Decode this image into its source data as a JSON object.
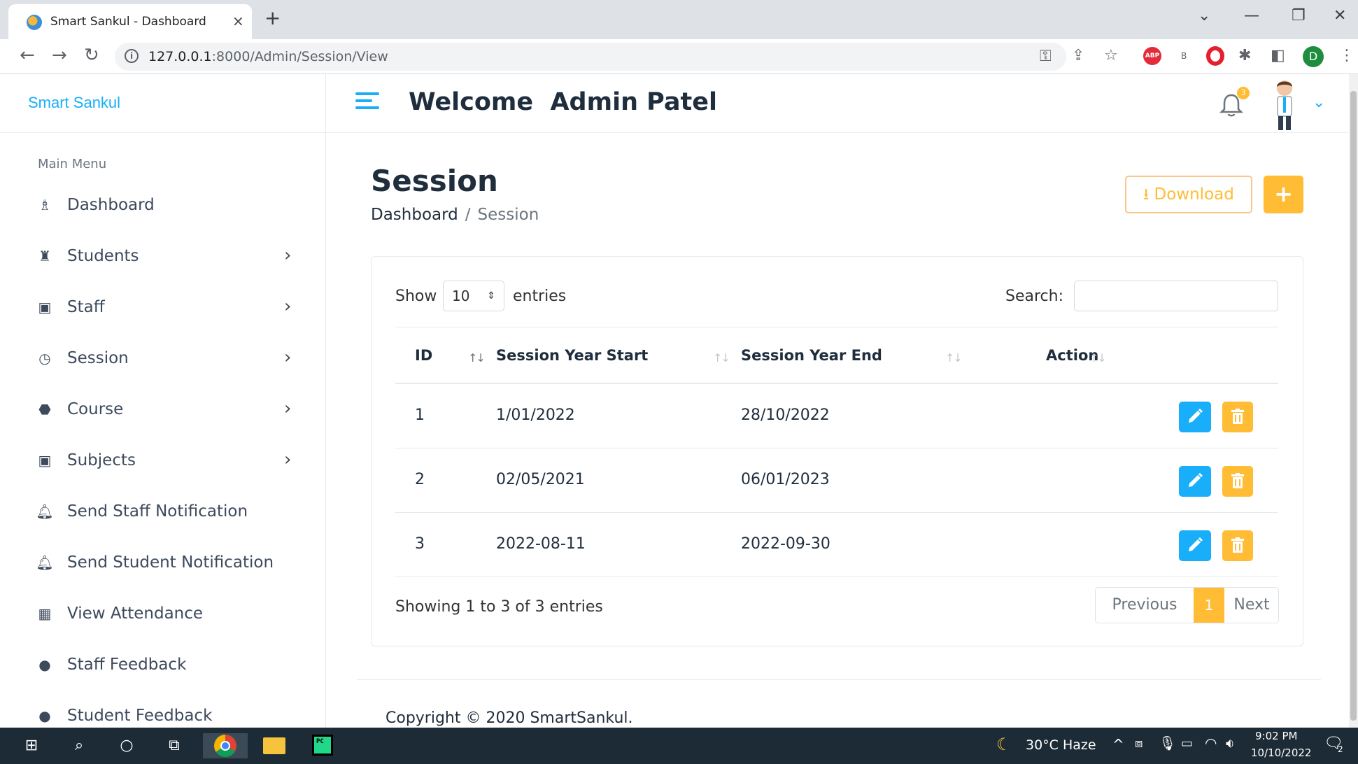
{
  "browser": {
    "tab_title": "Smart Sankul - Dashboard",
    "tab_close": "×",
    "new_tab": "+",
    "url_host": "127.0.0.1",
    "url_path": ":8000/Admin/Session/View"
  },
  "sidebar": {
    "brand": "Smart Sankul",
    "menu_title": "Main Menu",
    "items": [
      {
        "label": "Dashboard",
        "icon": "dashboard-icon",
        "has_submenu": false
      },
      {
        "label": "Students",
        "icon": "graduate-icon",
        "has_submenu": true
      },
      {
        "label": "Staff",
        "icon": "chalkboard-teacher-icon",
        "has_submenu": true
      },
      {
        "label": "Session",
        "icon": "clock-icon",
        "has_submenu": true
      },
      {
        "label": "Course",
        "icon": "graduation-cap-icon",
        "has_submenu": true
      },
      {
        "label": "Subjects",
        "icon": "chalkboard-teacher-icon",
        "has_submenu": true
      },
      {
        "label": "Send Staff Notification",
        "icon": "bell-icon",
        "has_submenu": false
      },
      {
        "label": "Send Student Notification",
        "icon": "bell-icon",
        "has_submenu": false
      },
      {
        "label": "View Attendance",
        "icon": "calendar-icon",
        "has_submenu": false
      },
      {
        "label": "Staff Feedback",
        "icon": "comments-icon",
        "has_submenu": false
      },
      {
        "label": "Student Feedback",
        "icon": "comments-icon",
        "has_submenu": false
      }
    ]
  },
  "header": {
    "welcome": "Welcome  Admin Patel",
    "notification_count": "3"
  },
  "page": {
    "title": "Session",
    "breadcrumb_home": "Dashboard",
    "breadcrumb_sep": "/",
    "breadcrumb_current": "Session",
    "download_label": "Download",
    "add_label": "+"
  },
  "table": {
    "show_label": "Show",
    "page_length": "10",
    "entries_label": "entries",
    "search_label": "Search:",
    "search_value": "",
    "columns": [
      "ID",
      "Session Year Start",
      "Session Year End",
      "Action"
    ],
    "rows": [
      {
        "id": "1",
        "start": "1/01/2022",
        "end": "28/10/2022"
      },
      {
        "id": "2",
        "start": "02/05/2021",
        "end": "06/01/2023"
      },
      {
        "id": "3",
        "start": "2022-08-11",
        "end": "2022-09-30"
      }
    ],
    "info": "Showing 1 to 3 of 3 entries",
    "prev_label": "Previous",
    "current_page": "1",
    "next_label": "Next"
  },
  "footer": {
    "copyright": "Copyright © 2020 SmartSankul."
  },
  "taskbar": {
    "weather": "30°C  Haze",
    "time": "9:02 PM",
    "date": "10/10/2022",
    "notifications": "2"
  },
  "colors": {
    "accent_blue": "#18aefa",
    "accent_orange": "#ffbc34",
    "text_dark": "#1f2d3d"
  }
}
